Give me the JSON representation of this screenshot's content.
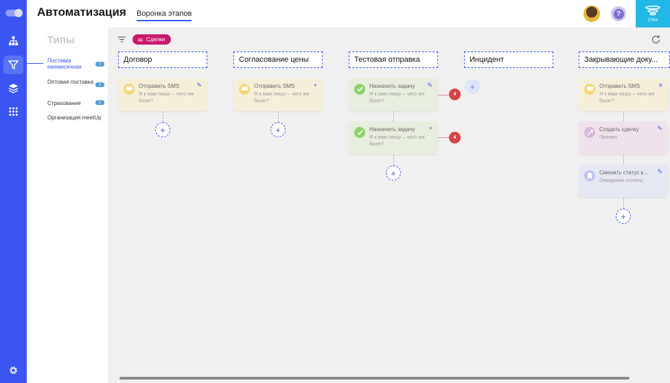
{
  "header": {
    "title": "Автоматизация",
    "tab_label": "Воронка этапов",
    "crm_label": "CRM"
  },
  "help": {
    "label": "?"
  },
  "types": {
    "heading": "Типы",
    "items": [
      {
        "label": "Поставка ежемесячная",
        "count": "7",
        "active": true
      },
      {
        "label": "Оптовая поставка",
        "count": "1"
      },
      {
        "label": "Страхование",
        "count": "1"
      },
      {
        "label": "Организация meetUp"
      }
    ]
  },
  "toolbar": {
    "chip_label": "Сделки"
  },
  "stages": [
    {
      "name": "Договор"
    },
    {
      "name": "Согласование цены"
    },
    {
      "name": "Тестовая отправка"
    },
    {
      "name": "Инцидент"
    },
    {
      "name": "Закрывающие доку..."
    }
  ],
  "cards": [
    {
      "title": "Отправить SMS",
      "desc": "Я к вам пишу – чего же боле?",
      "action": "✎"
    },
    {
      "title": "Отправить SMS",
      "desc": "Я к вам пишу – чего же боле?",
      "action": "+"
    },
    {
      "title": "Назначить задачу",
      "desc": "Я к вам пишу – чего же боле?",
      "action": "✎",
      "count": "4"
    },
    {
      "title": "Назначить задачу",
      "desc": "Я к вам пишу – чего же боле?",
      "action": "+",
      "count": "4"
    },
    {
      "title": "Отправить SMS",
      "desc": "Я к вам пишу – чего же боле?",
      "action": "≡"
    },
    {
      "title": "Создать сделку",
      "desc": "Примес",
      "action": "✎"
    },
    {
      "title": "Сменить статус к...",
      "desc": "Ожидание оплаты",
      "action": "✎"
    }
  ],
  "add_label": "+",
  "colors": {
    "accent": "#3a55f2",
    "chip": "#c8196e",
    "crm": "#21b7e6",
    "badge_red": "#d64343"
  }
}
